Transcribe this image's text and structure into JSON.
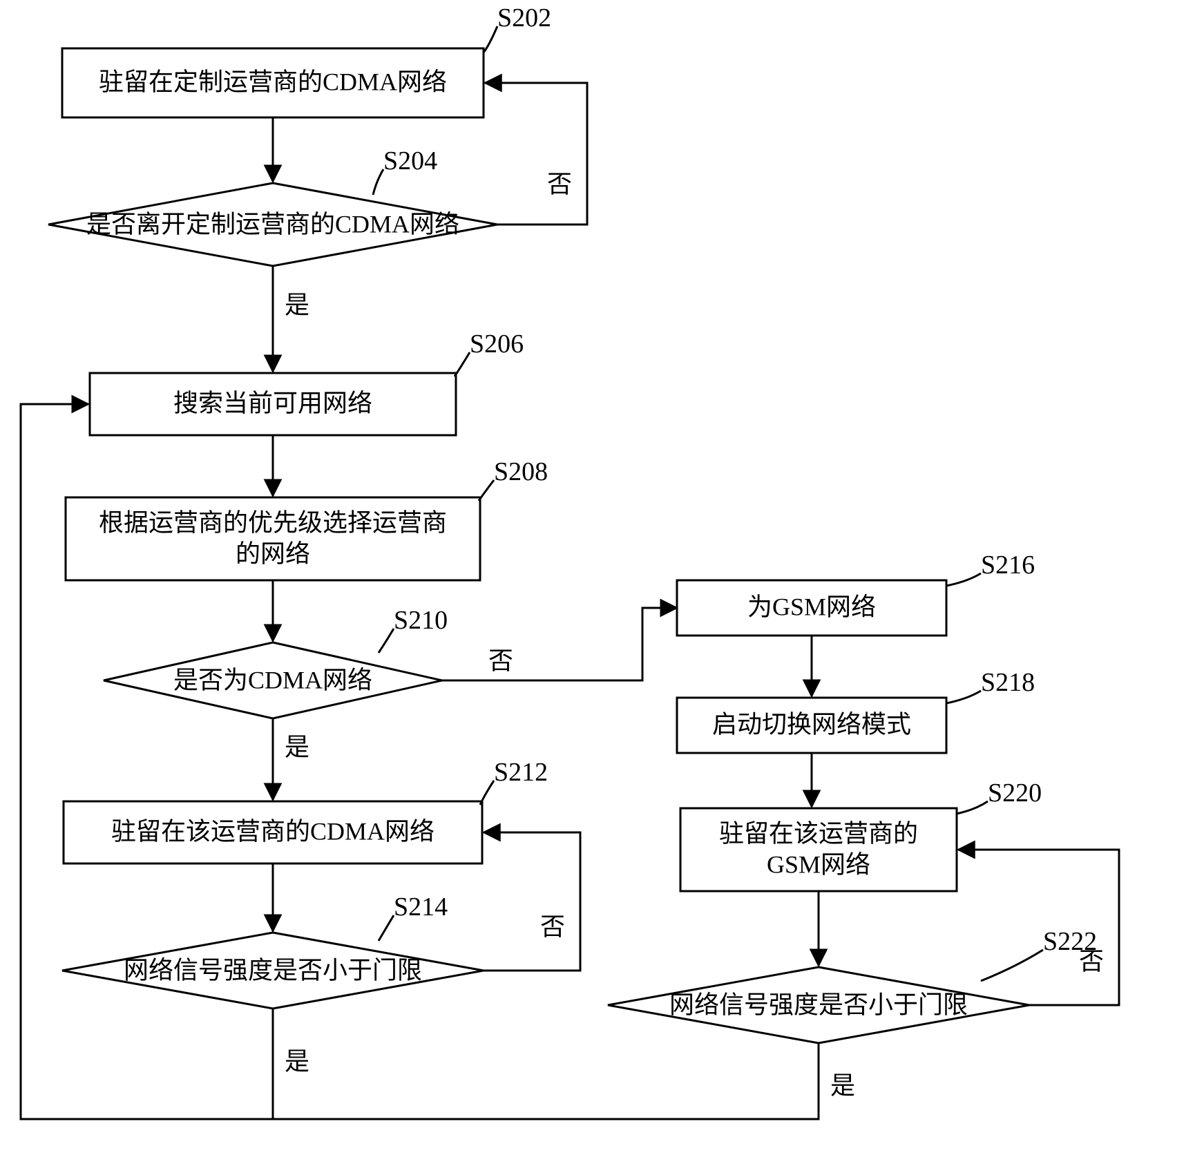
{
  "flowchart": {
    "labels": {
      "s202": "S202",
      "s204": "S204",
      "s206": "S206",
      "s208": "S208",
      "s210": "S210",
      "s212": "S212",
      "s214": "S214",
      "s216": "S216",
      "s218": "S218",
      "s220": "S220",
      "s222": "S222"
    },
    "nodes": {
      "n202": "驻留在定制运营商的CDMA网络",
      "n204": "是否离开定制运营商的CDMA网络",
      "n206": "搜索当前可用网络",
      "n208_l1": "根据运营商的优先级选择运营商",
      "n208_l2": "的网络",
      "n210": "是否为CDMA网络",
      "n212": "驻留在该运营商的CDMA网络",
      "n214": "网络信号强度是否小于门限",
      "n216": "为GSM网络",
      "n218": "启动切换网络模式",
      "n220_l1": "驻留在该运营商的",
      "n220_l2": "GSM网络",
      "n222": "网络信号强度是否小于门限"
    },
    "branches": {
      "yes": "是",
      "no": "否"
    }
  }
}
